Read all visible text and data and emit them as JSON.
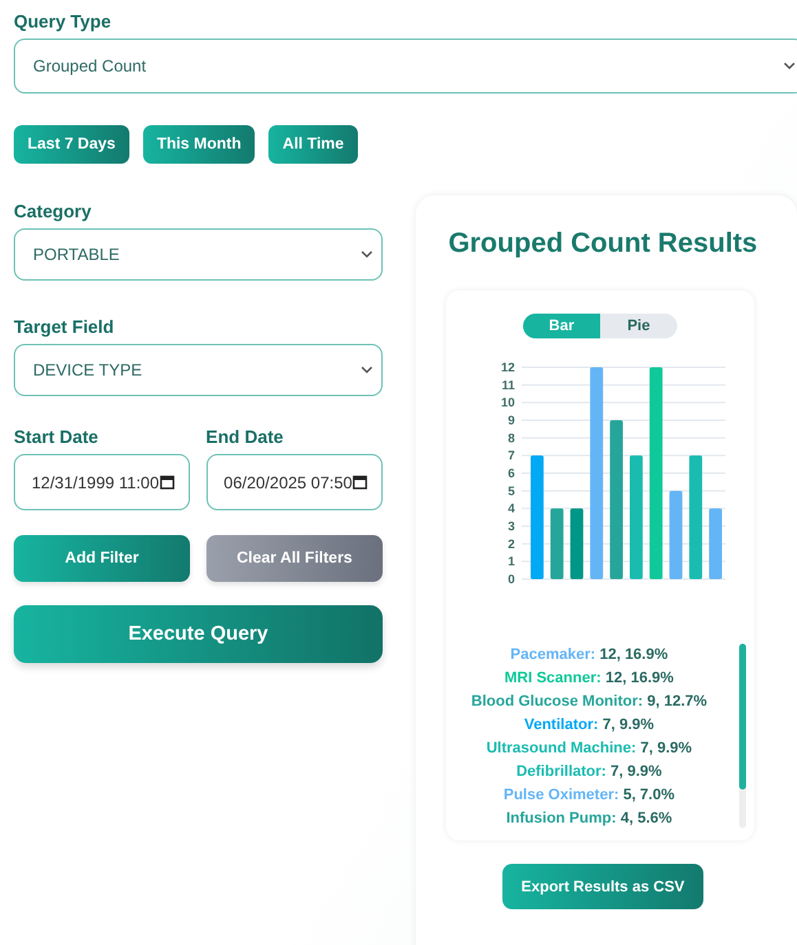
{
  "query_type": {
    "label": "Query Type",
    "value": "Grouped Count"
  },
  "presets": [
    {
      "label": "Last 7 Days"
    },
    {
      "label": "This Month"
    },
    {
      "label": "All Time"
    }
  ],
  "category": {
    "label": "Category",
    "value": "PORTABLE"
  },
  "target_field": {
    "label": "Target Field",
    "value": "DEVICE TYPE"
  },
  "start_date": {
    "label": "Start Date",
    "value": "12/31/1999 11:00"
  },
  "end_date": {
    "label": "End Date",
    "value": "06/20/2025 07:50"
  },
  "filter_buttons": [
    {
      "label": "Add Filter",
      "kind": "primary"
    },
    {
      "label": "Clear All Filters",
      "kind": "secondary"
    }
  ],
  "execute_button": "Execute Query",
  "results": {
    "title": "Grouped Count Results",
    "view_toggle": [
      {
        "label": "Bar",
        "selected": true
      },
      {
        "label": "Pie",
        "selected": false
      }
    ],
    "chart_data": {
      "type": "bar",
      "values": [
        7,
        4,
        4,
        12,
        9,
        7,
        12,
        5,
        7,
        4
      ],
      "colors": [
        "#03a9f4",
        "#26a69a",
        "#009688",
        "#64b5f6",
        "#26a69a",
        "#1abcb0",
        "#10c99a",
        "#64b5f6",
        "#1abcb0",
        "#64b5f6"
      ],
      "ylim": [
        0,
        12
      ],
      "grid": true,
      "yticks": [
        0,
        1,
        2,
        3,
        4,
        5,
        6,
        7,
        8,
        9,
        10,
        11,
        12
      ]
    },
    "legend": [
      {
        "label": "Pacemaker:",
        "value": "12, 16.9%",
        "color": "#64b5f6"
      },
      {
        "label": "MRI Scanner:",
        "value": "12, 16.9%",
        "color": "#10c99a"
      },
      {
        "label": "Blood Glucose Monitor:",
        "value": "9, 12.7%",
        "color": "#26a69a"
      },
      {
        "label": "Ventilator:",
        "value": "7, 9.9%",
        "color": "#03a9f4"
      },
      {
        "label": "Ultrasound Machine:",
        "value": "7, 9.9%",
        "color": "#1abcb0"
      },
      {
        "label": "Defibrillator:",
        "value": "7, 9.9%",
        "color": "#1abcb0"
      },
      {
        "label": "Pulse Oximeter:",
        "value": "5, 7.0%",
        "color": "#64b5f6"
      },
      {
        "label": "Infusion Pump:",
        "value": "4, 5.6%",
        "color": "#26a69a"
      }
    ],
    "export_button": "Export Results as CSV"
  }
}
